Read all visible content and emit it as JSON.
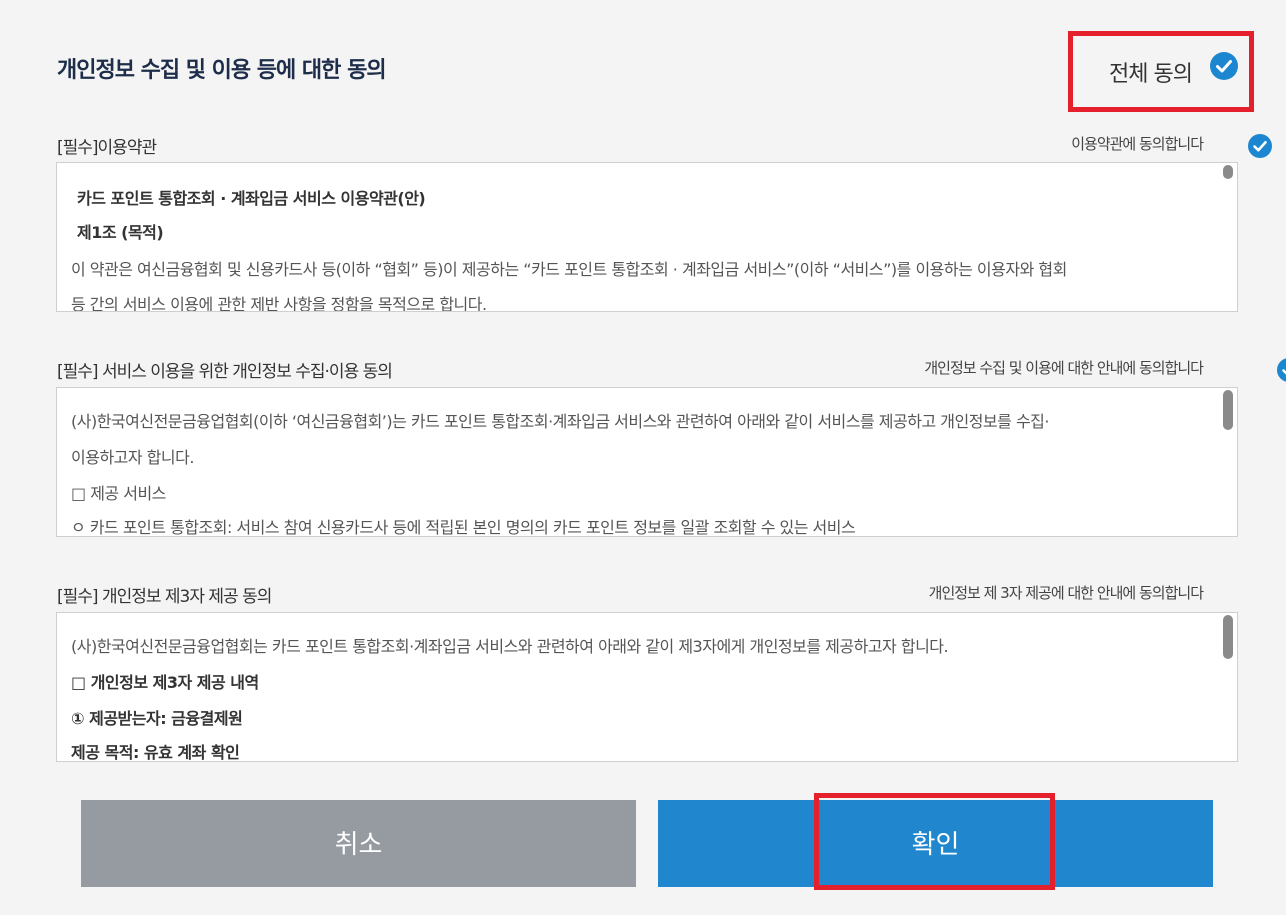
{
  "title": "개인정보 수집 및 이용 등에 대한 동의",
  "all_agree_label": "전체 동의",
  "sections": [
    {
      "title_prefix": "[필수]",
      "title": "이용약관",
      "agree_label": "이용약관에 동의합니다",
      "lines": [
        "카드 포인트 통합조회 · 계좌입금 서비스 이용약관(안)",
        "제1조 (목적)",
        "이 약관은 여신금융협회 및 신용카드사 등(이하 “협회” 등)이 제공하는 “카드 포인트 통합조회 · 계좌입금 서비스”(이하 “서비스”)를 이용하는 이용자와 협회",
        "등 간의 서비스 이용에 관한 제반 사항을 정함을 목적으로 합니다."
      ]
    },
    {
      "title_prefix": "[필수]",
      "title": " 서비스 이용을 위한 개인정보 수집·이용 동의",
      "agree_label": "개인정보 수집 및 이용에 대한 안내에 동의합니다",
      "lines": [
        "(사)한국여신전문금융업협회(이하 ‘여신금융협회’)는 카드 포인트 통합조회·계좌입금 서비스와 관련하여 아래와 같이 서비스를 제공하고 개인정보를 수집·",
        "이용하고자 합니다.",
        "□ 제공 서비스",
        "ㅇ 카드 포인트 통합조회: 서비스 참여 신용카드사 등에 적립된 본인 명의의 카드 포인트 정보를 일괄 조회할 수 있는 서비스"
      ]
    },
    {
      "title_prefix": "[필수]",
      "title": " 개인정보 제3자 제공 동의",
      "agree_label": "개인정보 제 3자 제공에 대한 안내에 동의합니다",
      "lines": [
        "(사)한국여신전문금융업협회는 카드 포인트 통합조회·계좌입금 서비스와 관련하여 아래와 같이 제3자에게 개인정보를 제공하고자 합니다.",
        "□ 개인정보 제3자 제공 내역",
        "① 제공받는자: 금융결제원",
        "제공 목적: 유효 계좌 확인"
      ]
    }
  ],
  "buttons": {
    "cancel": "취소",
    "confirm": "확인"
  },
  "colors": {
    "accent": "#2087cf",
    "check": "#1d86d0",
    "cancel": "#959ba1",
    "highlight": "#e3202b"
  }
}
